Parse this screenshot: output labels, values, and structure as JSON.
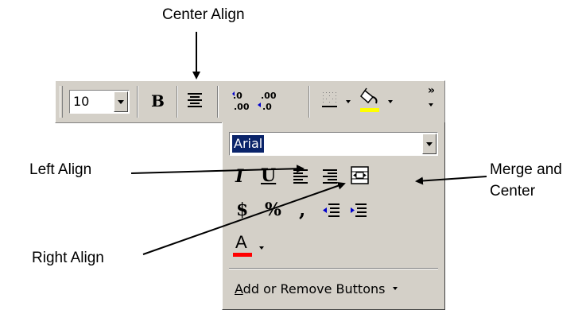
{
  "callouts": {
    "center_align": "Center Align",
    "left_align": "Left Align",
    "right_align": "Right Align",
    "merge_center_line1": "Merge and",
    "merge_center_line2": "Center"
  },
  "toolbar": {
    "font_size": "10",
    "bold_label": "B",
    "increase_decimal": "+.0\n.00",
    "decrease_decimal": ".00\n+.0",
    "overflow": "»"
  },
  "menu": {
    "font_name": "Arial",
    "italic_label": "I",
    "underline_label": "U",
    "currency_label": "$",
    "percent_label": "%",
    "comma_label": ",",
    "font_color_label": "A",
    "add_remove_prefix": "A",
    "add_remove_rest": "dd or Remove Buttons"
  },
  "colors": {
    "highlight_yellow": "#ffff00",
    "font_red": "#ff0000",
    "face": "#d4d0c8",
    "selection": "#0a246a"
  },
  "icons": [
    "center-align-icon",
    "left-align-icon",
    "right-align-icon",
    "merge-center-icon",
    "borders-icon",
    "fill-color-icon",
    "indent-icon",
    "outdent-icon"
  ]
}
